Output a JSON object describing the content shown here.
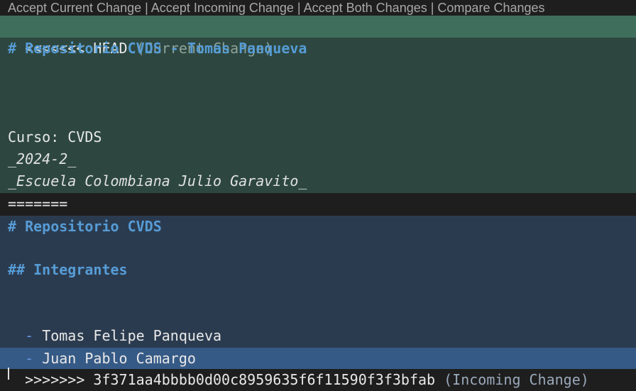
{
  "codelens": {
    "accept_current": "Accept Current Change",
    "accept_incoming": "Accept Incoming Change",
    "accept_both": "Accept Both Changes",
    "compare": "Compare Changes",
    "separator": " | "
  },
  "current": {
    "marker": "<<<<<<< HEAD",
    "hint": "(Current Change)",
    "title": "# Repositorio CVDS - Tomas Panqueva",
    "course": "Curso: CVDS",
    "period": "_2024-2_",
    "school": "_Escuela Colombiana Julio Garavito_"
  },
  "divider": "=======",
  "incoming": {
    "title": "# Repositorio CVDS",
    "subtitle": "## Integrantes",
    "bullet": "-",
    "member_1": "Tomas Felipe Panqueva",
    "member_2": "Juan Pablo Camargo",
    "marker": ">>>>>>> 3f371aa4bbbb0d00c8959635f6f11590f3f3bfab",
    "hint": "(Incoming Change)"
  },
  "colors": {
    "current_header": "#3f6e5d",
    "current_body": "#2d4740",
    "incoming_body": "#2b3b4f",
    "incoming_header": "#365a86",
    "markdown_heading": "#569cd6"
  }
}
